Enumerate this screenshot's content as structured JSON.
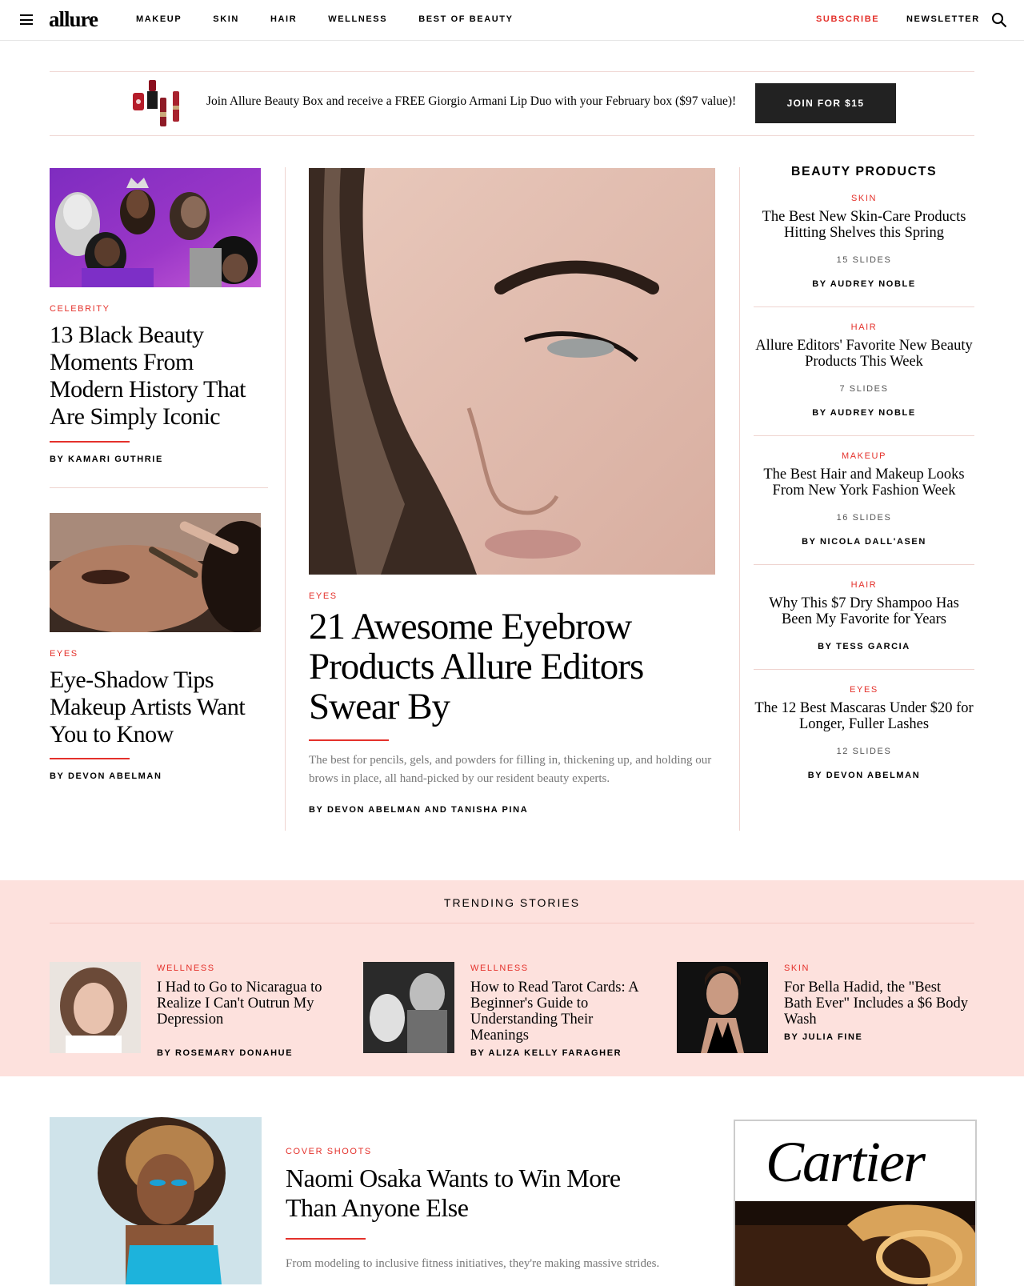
{
  "nav": {
    "logo": "allure",
    "links": [
      "Makeup",
      "Skin",
      "Hair",
      "Wellness",
      "Best of Beauty"
    ],
    "subscribe": "Subscribe",
    "newsletter": "Newsletter"
  },
  "promo": {
    "text": "Join Allure Beauty Box and receive a FREE Giorgio Armani Lip Duo with your February box ($97 value)!",
    "button": "Join for $15"
  },
  "left": [
    {
      "kicker": "Celebrity",
      "headline": "13 Black Beauty Moments From Modern History That Are Simply Iconic",
      "byline": "By Kamari Guthrie"
    },
    {
      "kicker": "Eyes",
      "headline": "Eye-Shadow Tips Makeup Artists Want You to Know",
      "byline": "By Devon Abelman"
    }
  ],
  "feature": {
    "kicker": "Eyes",
    "headline": "21 Awesome Eyebrow Products Allure Editors Swear By",
    "dek": "The best for pencils, gels, and powders for filling in, thickening up, and holding our brows in place, all hand-picked by our resident beauty experts.",
    "byline": "By Devon Abelman and Tanisha Pina"
  },
  "beauty_products": {
    "title": "Beauty Products",
    "items": [
      {
        "kicker": "Skin",
        "headline": "The Best New Skin-Care Products Hitting Shelves this Spring",
        "slides": "15 Slides",
        "byline": "By Audrey Noble"
      },
      {
        "kicker": "Hair",
        "headline": "Allure Editors' Favorite New Beauty Products This Week",
        "slides": "7 Slides",
        "byline": "By Audrey Noble"
      },
      {
        "kicker": "Makeup",
        "headline": "The Best Hair and Makeup Looks From New York Fashion Week",
        "slides": "16 Slides",
        "byline": "By Nicola Dall'Asen"
      },
      {
        "kicker": "Hair",
        "headline": "Why This $7 Dry Shampoo Has Been My Favorite for Years",
        "slides": "",
        "byline": "By Tess Garcia"
      },
      {
        "kicker": "Eyes",
        "headline": "The 12 Best Mascaras Under $20 for Longer, Fuller Lashes",
        "slides": "12 Slides",
        "byline": "By Devon Abelman"
      }
    ]
  },
  "trending": {
    "title": "Trending Stories",
    "items": [
      {
        "kicker": "Wellness",
        "headline": "I Had to Go to Nicaragua to Realize I Can't Outrun My Depression",
        "byline": "By Rosemary Donahue"
      },
      {
        "kicker": "Wellness",
        "headline": "How to Read Tarot Cards: A Beginner's Guide to Understanding Their Meanings",
        "byline": "By Aliza Kelly Faragher"
      },
      {
        "kicker": "Skin",
        "headline": "For Bella Hadid, the \"Best Bath Ever\" Includes a $6 Body Wash",
        "byline": "By Julia Fine"
      }
    ]
  },
  "cover": {
    "kicker": "Cover Shoots",
    "headline": "Naomi Osaka Wants to Win More Than Anyone Else",
    "dek": "From modeling to inclusive fitness initiatives, they're making massive strides."
  },
  "ad": {
    "brand": "Cartier"
  },
  "colors": {
    "accent": "#e4312b",
    "trending_bg": "#fde1dd",
    "button_bg": "#222222"
  }
}
